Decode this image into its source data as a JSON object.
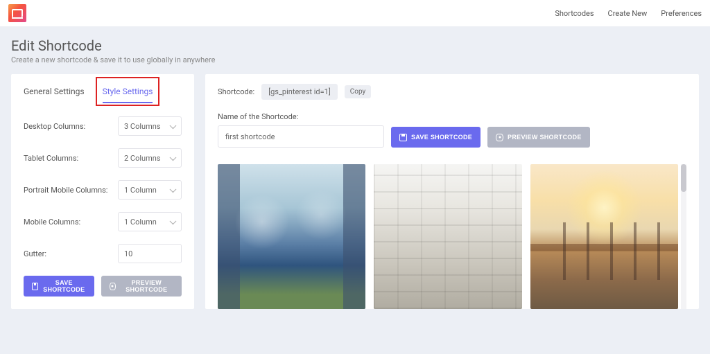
{
  "topnav": {
    "items": [
      "Shortcodes",
      "Create New",
      "Preferences"
    ]
  },
  "page": {
    "title": "Edit Shortcode",
    "subtitle": "Create a new shortcode & save it to use globally in anywhere"
  },
  "sidebar": {
    "tabs": {
      "general": "General Settings",
      "style": "Style Settings",
      "highlighted": "style"
    },
    "fields": {
      "desktop": {
        "label": "Desktop Columns:",
        "value": "3 Columns"
      },
      "tablet": {
        "label": "Tablet Columns:",
        "value": "2 Columns"
      },
      "portrait": {
        "label": "Portrait Mobile Columns:",
        "value": "1 Column"
      },
      "mobile": {
        "label": "Mobile Columns:",
        "value": "1 Column"
      },
      "gutter": {
        "label": "Gutter:",
        "value": "10"
      }
    },
    "buttons": {
      "save": "Save Shortcode",
      "preview": "Preview Shortcode"
    }
  },
  "main": {
    "shortcode_label": "Shortcode:",
    "shortcode_value": "[gs_pinterest id=1]",
    "copy": "Copy",
    "name_label": "Name of the Shortcode:",
    "name_value": "first shortcode",
    "buttons": {
      "save": "Save Shortcode",
      "preview": "Preview Shortcode"
    }
  }
}
